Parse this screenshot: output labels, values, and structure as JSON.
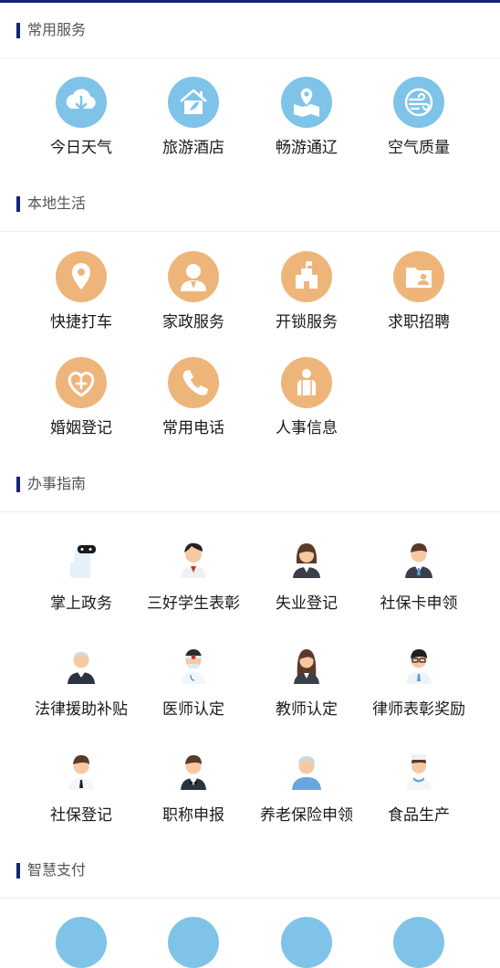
{
  "sections": [
    {
      "title": "常用服务"
    },
    {
      "title": "本地生活"
    },
    {
      "title": "办事指南"
    },
    {
      "title": "智慧支付"
    }
  ],
  "common_services": [
    {
      "label": "今日天气",
      "icon": "cloud-download-icon"
    },
    {
      "label": "旅游酒店",
      "icon": "hotel-icon"
    },
    {
      "label": "畅游通辽",
      "icon": "map-pin-icon"
    },
    {
      "label": "空气质量",
      "icon": "air-icon"
    }
  ],
  "local_life": [
    {
      "label": "快捷打车",
      "icon": "location-pin-icon"
    },
    {
      "label": "家政服务",
      "icon": "housekeeper-icon"
    },
    {
      "label": "开锁服务",
      "icon": "building-icon"
    },
    {
      "label": "求职招聘",
      "icon": "job-folder-icon"
    },
    {
      "label": "婚姻登记",
      "icon": "heart-plus-icon"
    },
    {
      "label": "常用电话",
      "icon": "phone-icon"
    },
    {
      "label": "人事信息",
      "icon": "personnel-icon"
    }
  ],
  "guides": [
    {
      "label": "掌上政务",
      "icon": "robot-icon"
    },
    {
      "label": "三好学生表彰",
      "icon": "student-icon"
    },
    {
      "label": "失业登记",
      "icon": "woman-avatar-icon"
    },
    {
      "label": "社保卡申领",
      "icon": "man-avatar-icon"
    },
    {
      "label": "法律援助补贴",
      "icon": "elder-man-icon"
    },
    {
      "label": "医师认定",
      "icon": "doctor-icon"
    },
    {
      "label": "教师认定",
      "icon": "teacher-icon"
    },
    {
      "label": "律师表彰奖励",
      "icon": "lawyer-icon"
    },
    {
      "label": "社保登记",
      "icon": "man-tie-icon"
    },
    {
      "label": "职称申报",
      "icon": "man-bowtie-icon"
    },
    {
      "label": "养老保险申领",
      "icon": "elder-icon"
    },
    {
      "label": "食品生产",
      "icon": "chef-icon"
    }
  ],
  "colors": {
    "accent": "#14237a",
    "blue_icon": "#7fc3e8",
    "orange_icon": "#eeb57a"
  }
}
